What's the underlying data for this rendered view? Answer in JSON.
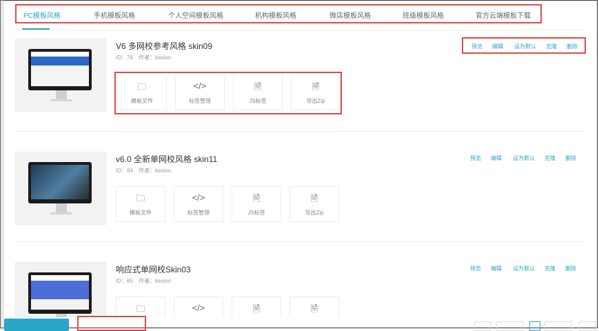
{
  "tabs": [
    {
      "label": "PC模板风格",
      "active": true
    },
    {
      "label": "手机模板风格"
    },
    {
      "label": "个人空间模板风格"
    },
    {
      "label": "机构模板风格"
    },
    {
      "label": "微店模板风格"
    },
    {
      "label": "班级模板风格"
    },
    {
      "label": "官方云端模板下载"
    }
  ],
  "actions": {
    "preview": "预览",
    "edit": "编辑",
    "set_default": "设为默认",
    "copy": "克隆",
    "delete": "删除"
  },
  "tools": [
    {
      "label": "模板文件",
      "icon": "folder-icon"
    },
    {
      "label": "标签管理",
      "icon": "code-icon"
    },
    {
      "label": "JS标签",
      "icon": "js-file-icon"
    },
    {
      "label": "导出Zip",
      "icon": "zip-file-icon"
    }
  ],
  "templates": [
    {
      "title": "V6 多网校参考风格 skin09",
      "id": "ID：76",
      "author": "作者：kesion"
    },
    {
      "title": "v6.0 全新单网校风格 skin11",
      "id": "ID：84",
      "author": "作者：kesion"
    },
    {
      "title": "响应式单网校Skin03",
      "id": "ID：65",
      "author": "作者：kesion"
    }
  ],
  "colors": {
    "accent": "#2aa6c8",
    "highlight": "#e04a4a"
  }
}
